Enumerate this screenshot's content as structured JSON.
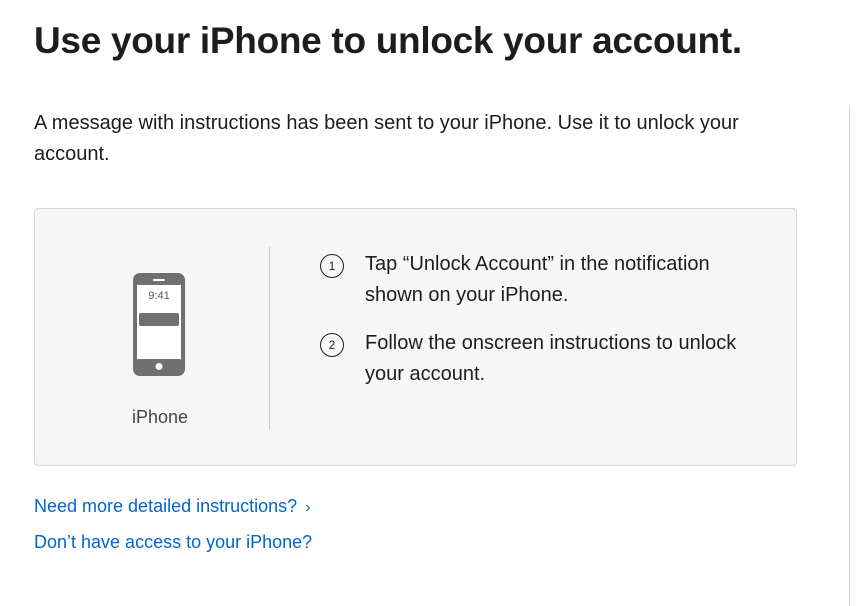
{
  "header": {
    "title": "Use your iPhone to unlock your account."
  },
  "intro": {
    "text": "A message with instructions has been sent to your iPhone. Use it to unlock your account."
  },
  "device": {
    "time": "9:41",
    "label": "iPhone",
    "icon": "iphone-icon"
  },
  "steps": [
    {
      "number": "1",
      "text": "Tap “Unlock Account” in the notification shown on your iPhone."
    },
    {
      "number": "2",
      "text": "Follow the onscreen instructions to unlock your account."
    }
  ],
  "links": {
    "detailed": "Need more detailed instructions?",
    "detailed_icon": "chevron-right-icon",
    "no_access": "Don’t have access to your iPhone?"
  },
  "colors": {
    "text": "#1d1d1f",
    "link": "#0066cc",
    "card_background": "#f7f7f7",
    "card_border": "#d6d6d6"
  }
}
